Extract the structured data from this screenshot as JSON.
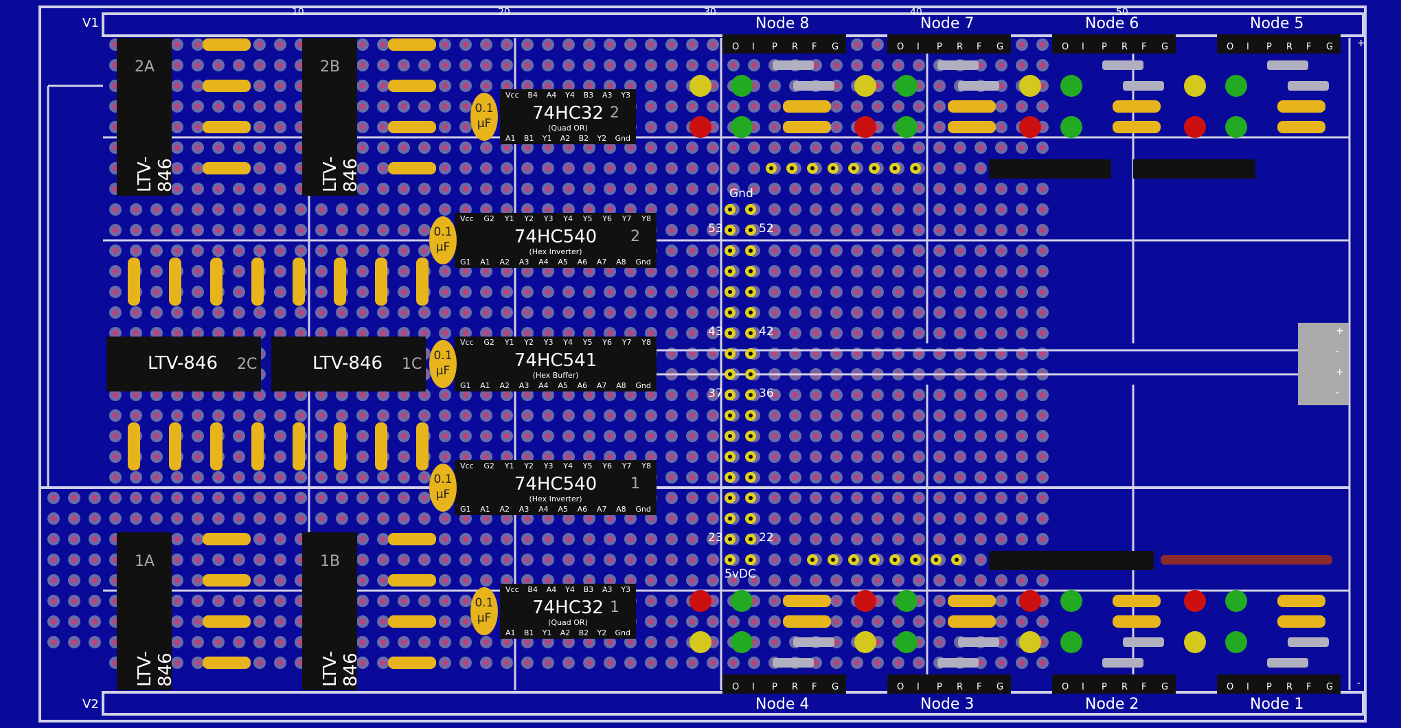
{
  "rails": {
    "v1_label": "V1",
    "v2_label": "V2"
  },
  "column_ticks": [
    "10",
    "20",
    "30",
    "40",
    "50"
  ],
  "nodes_top": [
    "Node 8",
    "Node 7",
    "Node 6",
    "Node 5"
  ],
  "nodes_bottom": [
    "Node 4",
    "Node 3",
    "Node 2",
    "Node 1"
  ],
  "header_pins": [
    "O",
    "I",
    "P",
    "R",
    "F",
    "G"
  ],
  "power_labels": {
    "gnd": "Gnd",
    "vdc": "5vDC"
  },
  "pin_numbers": {
    "p53": "53",
    "p52": "52",
    "p43": "43",
    "p42": "42",
    "p37": "37",
    "p36": "36",
    "p23": "23",
    "p22": "22"
  },
  "power_connector_signs": [
    "+",
    "-",
    "+",
    "-"
  ],
  "rail_signs": {
    "top_plus": "+",
    "bottom_minus": "-"
  },
  "led_signs": {
    "plus": "+",
    "minus": "-"
  },
  "chips": {
    "or2": {
      "name": "74HC32",
      "sub": "(Quad OR)",
      "num": "2",
      "top_pins": [
        "Vcc",
        "B4",
        "A4",
        "Y4",
        "B3",
        "A3",
        "Y3"
      ],
      "bot_pins": [
        "A1",
        "B1",
        "Y1",
        "A2",
        "B2",
        "Y2",
        "Gnd"
      ]
    },
    "inv2": {
      "name": "74HC540",
      "sub": "(Hex Inverter)",
      "num": "2",
      "top_pins": [
        "Vcc",
        "G2",
        "Y1",
        "Y2",
        "Y3",
        "Y4",
        "Y5",
        "Y6",
        "Y7",
        "Y8"
      ],
      "bot_pins": [
        "G1",
        "A1",
        "A2",
        "A3",
        "A4",
        "A5",
        "A6",
        "A7",
        "A8",
        "Gnd"
      ]
    },
    "buf": {
      "name": "74HC541",
      "sub": "(Hex Buffer)",
      "num": "",
      "top_pins": [
        "Vcc",
        "G2",
        "Y1",
        "Y2",
        "Y3",
        "Y4",
        "Y5",
        "Y6",
        "Y7",
        "Y8"
      ],
      "bot_pins": [
        "G1",
        "A1",
        "A2",
        "A3",
        "A4",
        "A5",
        "A6",
        "A7",
        "A8",
        "Gnd"
      ]
    },
    "inv1": {
      "name": "74HC540",
      "sub": "(Hex Inverter)",
      "num": "1",
      "top_pins": [
        "Vcc",
        "G2",
        "Y1",
        "Y2",
        "Y3",
        "Y4",
        "Y5",
        "Y6",
        "Y7",
        "Y8"
      ],
      "bot_pins": [
        "G1",
        "A1",
        "A2",
        "A3",
        "A4",
        "A5",
        "A6",
        "A7",
        "A8",
        "Gnd"
      ]
    },
    "or1": {
      "name": "74HC32",
      "sub": "(Quad OR)",
      "num": "1",
      "top_pins": [
        "Vcc",
        "B4",
        "A4",
        "Y4",
        "B3",
        "A3",
        "Y3"
      ],
      "bot_pins": [
        "A1",
        "B1",
        "Y1",
        "A2",
        "B2",
        "Y2",
        "Gnd"
      ]
    }
  },
  "cap_label": {
    "value": "0.1",
    "unit": "μF"
  },
  "optos": {
    "name": "LTV-846",
    "ids": [
      "2A",
      "2B",
      "2C",
      "1C",
      "1A",
      "1B"
    ]
  },
  "colors": {
    "board": "#0a0a9a",
    "pad_ring": "#6a6aa8",
    "pad_hole": "#c0407a",
    "trace": "#d0d0e8",
    "resistor": "#e8b41c",
    "led_red": "#cc1010",
    "led_green": "#22aa22",
    "led_yellow": "#d4c81c"
  }
}
